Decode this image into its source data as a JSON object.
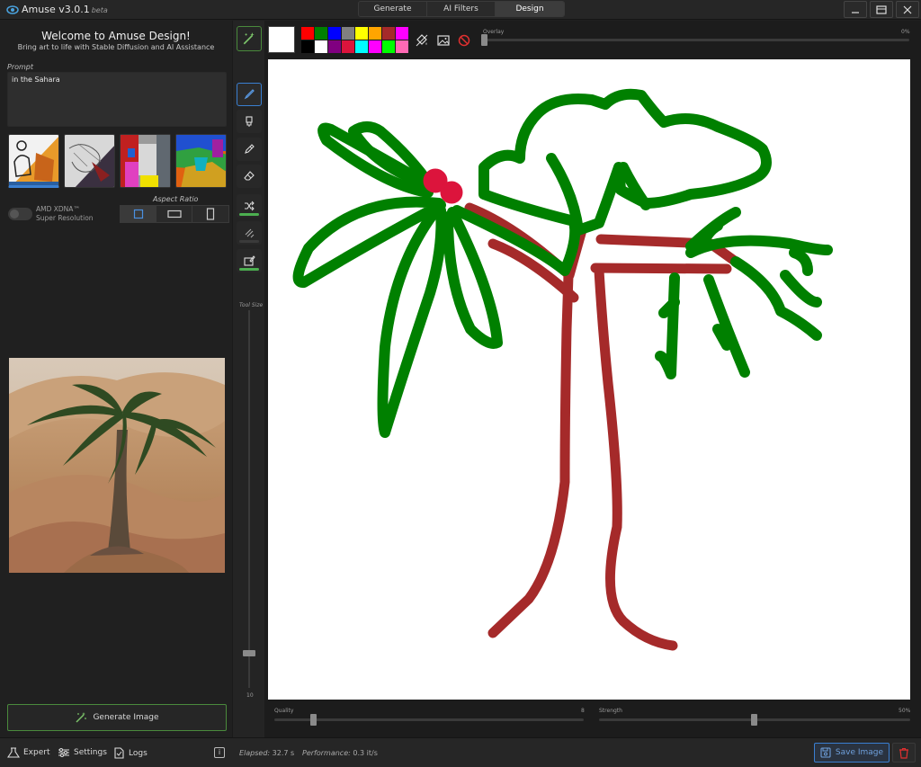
{
  "app": {
    "title": "Amuse v3.0.1",
    "beta": "beta"
  },
  "mode_tabs": [
    {
      "label": "Generate",
      "active": false
    },
    {
      "label": "AI Filters",
      "active": false
    },
    {
      "label": "Design",
      "active": true
    }
  ],
  "left": {
    "welcome": "Welcome to Amuse Design!",
    "subtitle": "Bring art to life with Stable Diffusion and AI Assistance",
    "prompt_label": "Prompt",
    "prompt_value": "in the Sahara",
    "xdna_label_line1": "AMD XDNA™",
    "xdna_label_line2": "Super Resolution",
    "aspect_label": "Aspect Ratio",
    "generate_label": "Generate Image"
  },
  "toolbar": {
    "tool_size_label": "Tool Size",
    "tool_size_value": "10",
    "icons": [
      "magic-wand-icon",
      "brush-icon",
      "paint-bucket-icon",
      "pen-icon",
      "eraser-icon",
      "shuffle-icon",
      "pencil-lines-icon",
      "edit-box-icon"
    ]
  },
  "canvas": {
    "overlay_label": "Overlay",
    "overlay_value": "0%",
    "quality_label": "Quality",
    "quality_value": "8",
    "strength_label": "Strength",
    "strength_value": "50%",
    "selected_color": "#FFFFFF",
    "palette": [
      "#FF0000",
      "#008000",
      "#0000FF",
      "#808080",
      "#FFFF00",
      "#FFA500",
      "#A52A2A",
      "#FF00FF",
      "#000000",
      "#FFFFFF",
      "#800080",
      "#DC143C",
      "#00FFFF",
      "#FF00FF",
      "#00FF00",
      "#FF69B4"
    ]
  },
  "status": {
    "expert": "Expert",
    "settings": "Settings",
    "logs": "Logs",
    "elapsed_label": "Elapsed:",
    "elapsed_value": "32.7 s",
    "performance_label": "Performance:",
    "performance_value": "0.3 it/s",
    "save_label": "Save Image"
  },
  "colors": {
    "accent_blue": "#3a7fd1",
    "accent_green": "#4a8a3c",
    "trunk": "#A52A2A",
    "leaves": "#008000"
  }
}
